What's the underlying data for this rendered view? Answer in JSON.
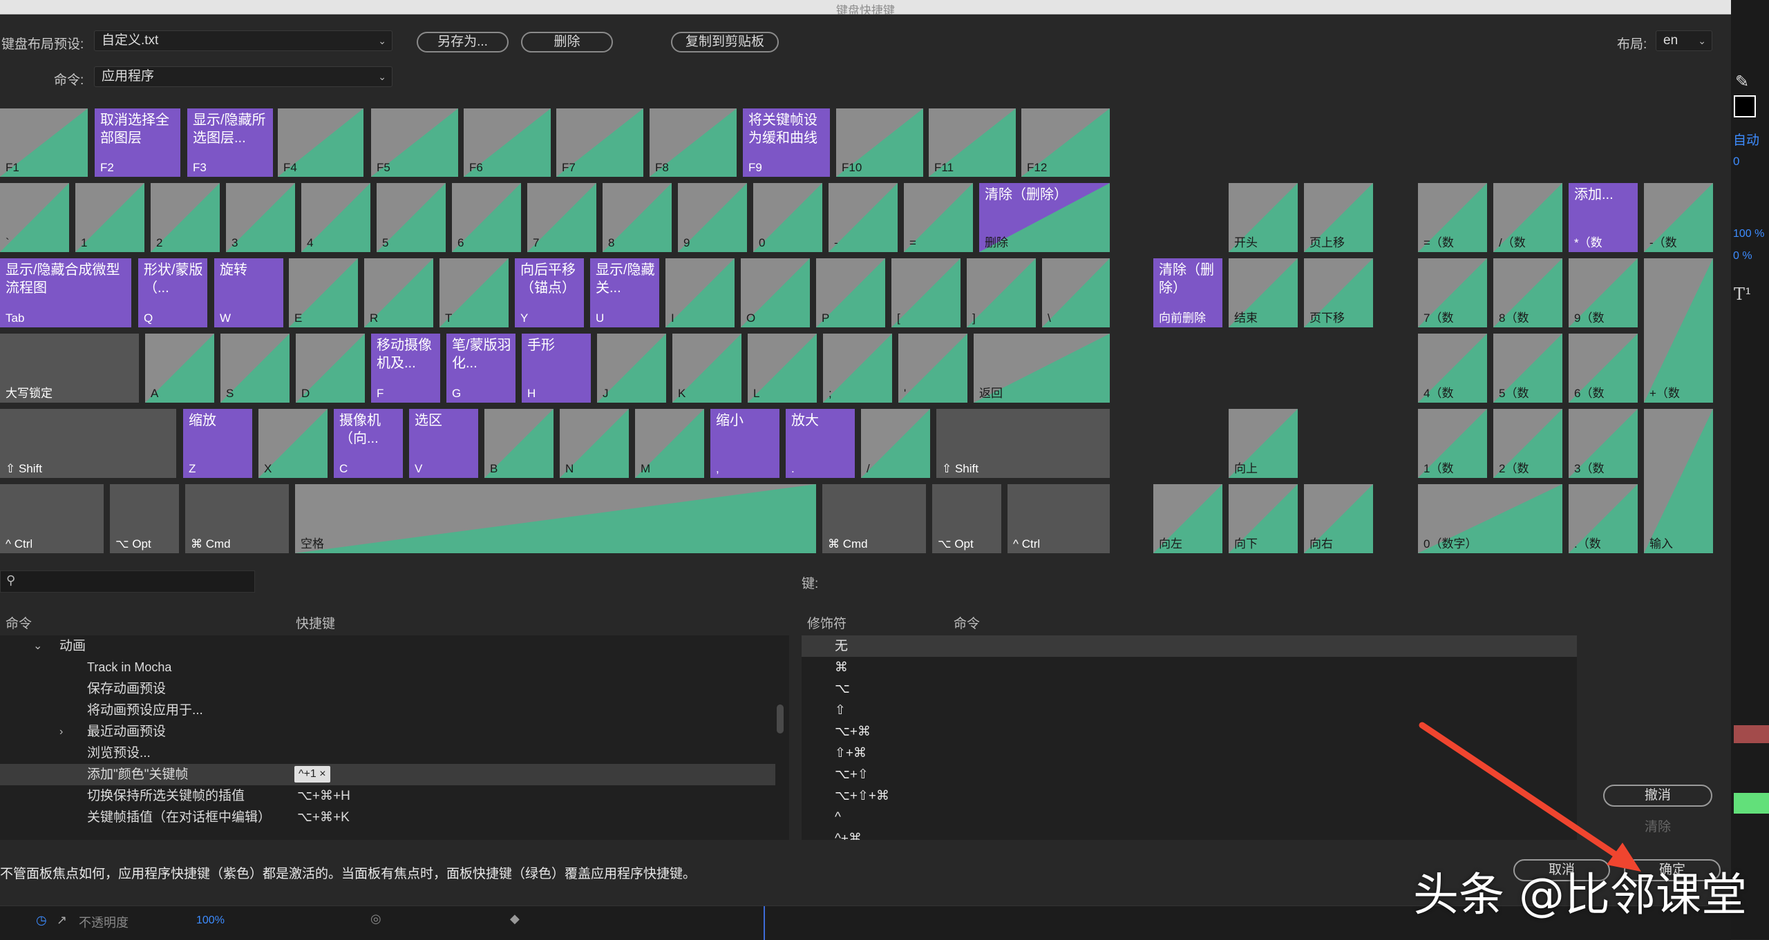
{
  "window": {
    "title": "键盘快捷键"
  },
  "toolbar": {
    "preset_label": "键盘布局预设:",
    "preset_value": "自定义.txt",
    "save_as": "另存为...",
    "delete": "删除",
    "copy_clipboard": "复制到剪贴板",
    "layout_label": "布局:",
    "layout_value": "en",
    "command_label": "命令:",
    "command_value": "应用程序"
  },
  "colors": {
    "app_shortcut": "#7d56c6",
    "panel_shortcut": "#4fb28c",
    "unassigned": "#555555"
  },
  "keys": {
    "f1": "F1",
    "f2": "F2",
    "f2_cmd": "取消选择全部图层",
    "f3": "F3",
    "f3_cmd": "显示/隐藏所选图层...",
    "f4": "F4",
    "f5": "F5",
    "f6": "F6",
    "f7": "F7",
    "f8": "F8",
    "f9": "F9",
    "f9_cmd": "将关键帧设为缓和曲线",
    "f10": "F10",
    "f11": "F11",
    "f12": "F12",
    "grave": "`",
    "k1": "1",
    "k2": "2",
    "k3": "3",
    "k4": "4",
    "k5": "5",
    "k6": "6",
    "k7": "7",
    "k8": "8",
    "k9": "9",
    "k0": "0",
    "minus": "-",
    "equal": "=",
    "backspace": "删除",
    "backspace_cmd": "清除（删除）",
    "tab": "Tab",
    "tab_cmd": "显示/隐藏合成微型流程图",
    "q": "Q",
    "q_cmd": "形状/蒙版（...",
    "w": "W",
    "w_cmd": "旋转",
    "e": "E",
    "r": "R",
    "t": "T",
    "y": "Y",
    "y_cmd": "向后平移（锚点）",
    "u": "U",
    "u_cmd": "显示/隐藏关...",
    "i": "I",
    "o": "O",
    "p": "P",
    "lbr": "[",
    "rbr": "]",
    "bslash": "\\",
    "caps": "大写锁定",
    "a": "A",
    "s": "S",
    "d": "D",
    "f": "F",
    "f_cmd": "移动摄像机及...",
    "g": "G",
    "g_cmd": "笔/蒙版羽化...",
    "h": "H",
    "h_cmd": "手形",
    "j": "J",
    "k": "K",
    "l": "L",
    "semi": ";",
    "quote": "'",
    "enter": "返回",
    "lshift": "⇧ Shift",
    "z": "Z",
    "z_cmd": "缩放",
    "x": "X",
    "c": "C",
    "c_cmd": "摄像机（向...",
    "v": "V",
    "v_cmd": "选区",
    "b": "B",
    "n": "N",
    "m": "M",
    "comma": ",",
    "comma_cmd": "缩小",
    "period": ".",
    "period_cmd": "放大",
    "slash": "/",
    "rshift": "⇧ Shift",
    "lctrl": "^ Ctrl",
    "lopt": "⌥ Opt",
    "lcmd": "⌘ Cmd",
    "space": "空格",
    "rcmd": "⌘ Cmd",
    "ropt": "⌥ Opt",
    "rctrl": "^ Ctrl",
    "home": "开头",
    "pgup": "页上移",
    "fdel": "向前删除",
    "fdel_cmd": "清除（删除）",
    "end": "结束",
    "pgdn": "页下移",
    "up": "向上",
    "left": "向左",
    "down": "向下",
    "right": "向右",
    "np_eq": "=（数",
    "np_div": "/（数",
    "np_mul": "*（数",
    "np_mul_cmd": "添加...",
    "np_sub": "-（数",
    "np7": "7（数",
    "np8": "8（数",
    "np9": "9（数",
    "np_add": "+（数",
    "np4": "4（数",
    "np5": "5（数",
    "np6": "6（数",
    "np1": "1（数",
    "np2": "2（数",
    "np3": "3（数",
    "np_enter": "输入",
    "np0": "0（数字）",
    "np_dot": ".（数"
  },
  "lower": {
    "key_label": "键:",
    "col_command": "命令",
    "col_shortcut": "快捷键",
    "col_modifier": "修饰符",
    "col_mod_command": "命令",
    "group": "动画",
    "rows": [
      {
        "cmd": "Track in Mocha",
        "sc": ""
      },
      {
        "cmd": "保存动画预设",
        "sc": ""
      },
      {
        "cmd": "将动画预设应用于...",
        "sc": ""
      },
      {
        "cmd": "最近动画预设",
        "sc": ""
      },
      {
        "cmd": "浏览预设...",
        "sc": ""
      },
      {
        "cmd": "添加\"颜色\"关键帧",
        "sc": "^+1 ×"
      },
      {
        "cmd": "切换保持所选关键帧的插值",
        "sc": "⌥+⌘+H"
      },
      {
        "cmd": "关键帧插值（在对话框中编辑）",
        "sc": "⌥+⌘+K"
      }
    ],
    "modifiers": [
      "无",
      "⌘",
      "⌥",
      "⇧",
      "⌥+⌘",
      "⇧+⌘",
      "⌥+⇧",
      "⌥+⇧+⌘",
      "^",
      "^+⌘"
    ],
    "undo": "撤消",
    "clear": "清除",
    "cancel": "取消",
    "ok": "确定",
    "note": "不管面板焦点如何，应用程序快捷键（紫色）都是激活的。当面板有焦点时，面板快捷键（绿色）覆盖应用程序快捷键。"
  },
  "right_strip": {
    "auto": "自动",
    "zero": "0",
    "pct1": "100 %",
    "pct2": "0 %"
  },
  "bottom": {
    "opacity_label": "不透明度",
    "opacity_value": "100%"
  },
  "watermark": "头条 @比邻课堂"
}
